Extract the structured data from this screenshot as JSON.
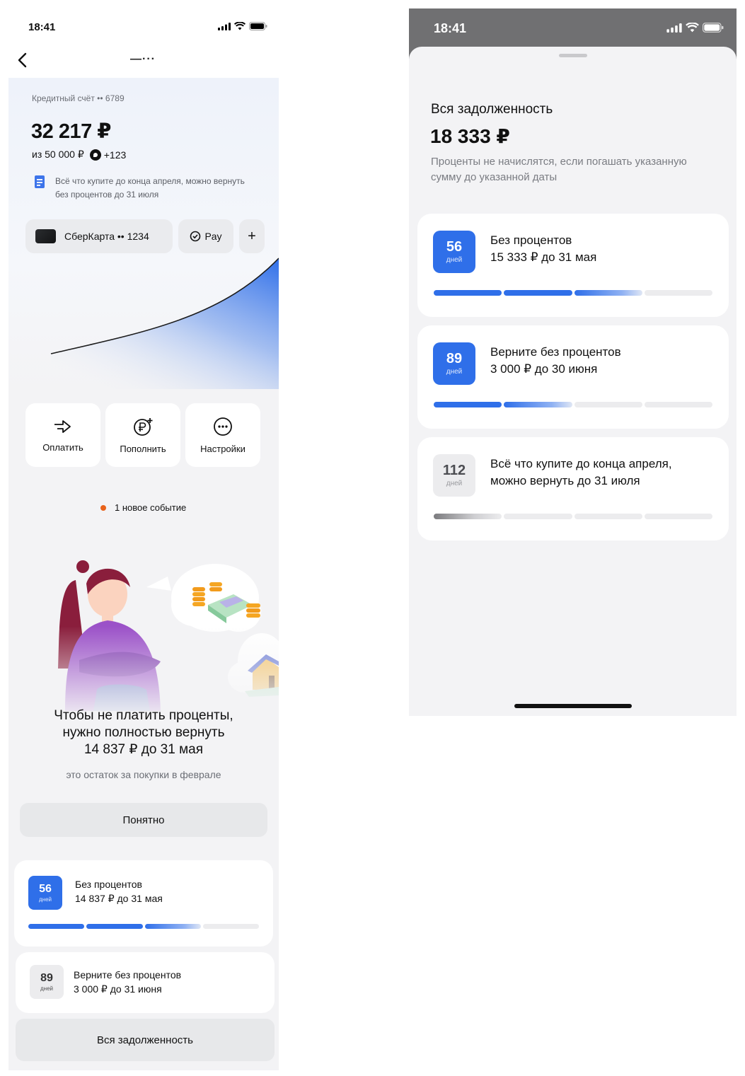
{
  "left": {
    "status": {
      "time": "18:41"
    },
    "nav": {
      "more": "—···"
    },
    "account": {
      "label": "Кредитный счёт •• 6789",
      "balance": "32 217 ₽",
      "limit": "из 50 000 ₽",
      "bonus": "+123",
      "info": "Всё что купите до конца апреля, можно вернуть без процентов до 31 июля"
    },
    "chips": {
      "card": "СберКарта •• 1234",
      "pay": "Pay",
      "add": "+"
    },
    "actions": [
      {
        "label": "Оплатить",
        "icon": "arrow-right-icon"
      },
      {
        "label": "Пополнить",
        "icon": "ruble-plus-icon"
      },
      {
        "label": "Настройки",
        "icon": "more-circle-icon"
      }
    ],
    "event": "1 новое событие",
    "promo": {
      "line1": "Чтобы не платить проценты,",
      "line2": "нужно полностью вернуть",
      "line3": "14 837 ₽ до 31 мая",
      "sub": "это остаток за покупки в феврале",
      "button": "Понятно"
    },
    "periods": [
      {
        "days": "56",
        "unit": "дней",
        "title": "Без процентов",
        "detail": "14 837 ₽ до 31 мая",
        "progress": 0.75
      },
      {
        "days": "89",
        "unit": "дней",
        "title": "Верните без процентов",
        "detail": "3 000 ₽ до 31 июня"
      }
    ],
    "all_debt_button": "Вся задолженность"
  },
  "right": {
    "status": {
      "time": "18:41"
    },
    "title": "Вся задолженность",
    "total": "18 333 ₽",
    "desc": "Проценты не начислятся, если погашать указанную сумму до указанной даты",
    "periods": [
      {
        "days": "56",
        "unit": "дней",
        "title": "Без процентов",
        "detail": "15 333 ₽ до 31 мая",
        "progress": 0.75
      },
      {
        "days": "89",
        "unit": "дней",
        "title": "Верните без процентов",
        "detail": "3 000 ₽ до 30 июня",
        "progress": 0.5
      },
      {
        "days": "112",
        "unit": "дней",
        "title": "Всё что купите до конца апреля,",
        "detail": "можно вернуть до 31 июля",
        "progress": 0.25
      }
    ]
  },
  "colors": {
    "accent": "#2f6fe9",
    "event_dot": "#e8621a",
    "background": "#f3f3f5"
  }
}
